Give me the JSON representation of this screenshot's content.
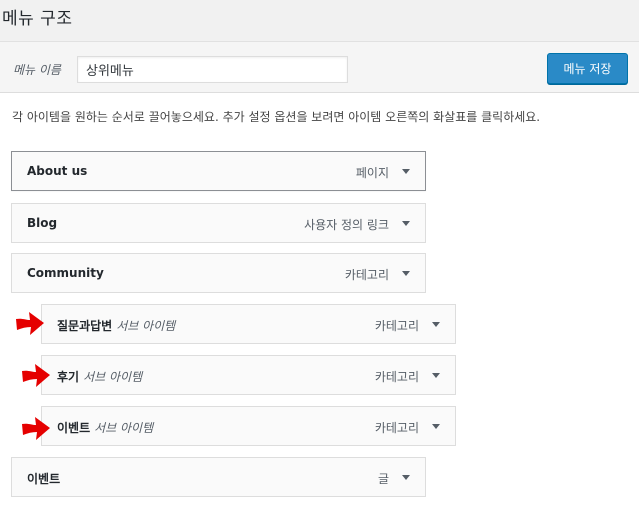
{
  "page": {
    "title": "메뉴 구조"
  },
  "header": {
    "name_label": "메뉴 이름",
    "name_value": "상위메뉴",
    "save_label": "메뉴 저장"
  },
  "instructions": "각 아이템을 원하는 순서로 끌어놓으세요. 추가 설정 옵션을 보려면 아이템 오른쪽의 화살표를 클릭하세요.",
  "menu_items": [
    {
      "title": "About us",
      "sub": "",
      "type": "페이지"
    },
    {
      "title": "Blog",
      "sub": "",
      "type": "사용자 정의 링크"
    },
    {
      "title": "Community",
      "sub": "",
      "type": "카테고리"
    },
    {
      "title": "질문과답변",
      "sub": "서브 아이템",
      "type": "카테고리"
    },
    {
      "title": "후기",
      "sub": "서브 아이템",
      "type": "카테고리"
    },
    {
      "title": "이벤트",
      "sub": "서브 아이템",
      "type": "카테고리"
    },
    {
      "title": "이벤트",
      "sub": "",
      "type": "글"
    }
  ],
  "icons": {
    "toggle": "triangle-down-icon",
    "annotation": "red-arrow-icon"
  },
  "colors": {
    "accent": "#2a8ac7",
    "annotation": "#e50000"
  }
}
